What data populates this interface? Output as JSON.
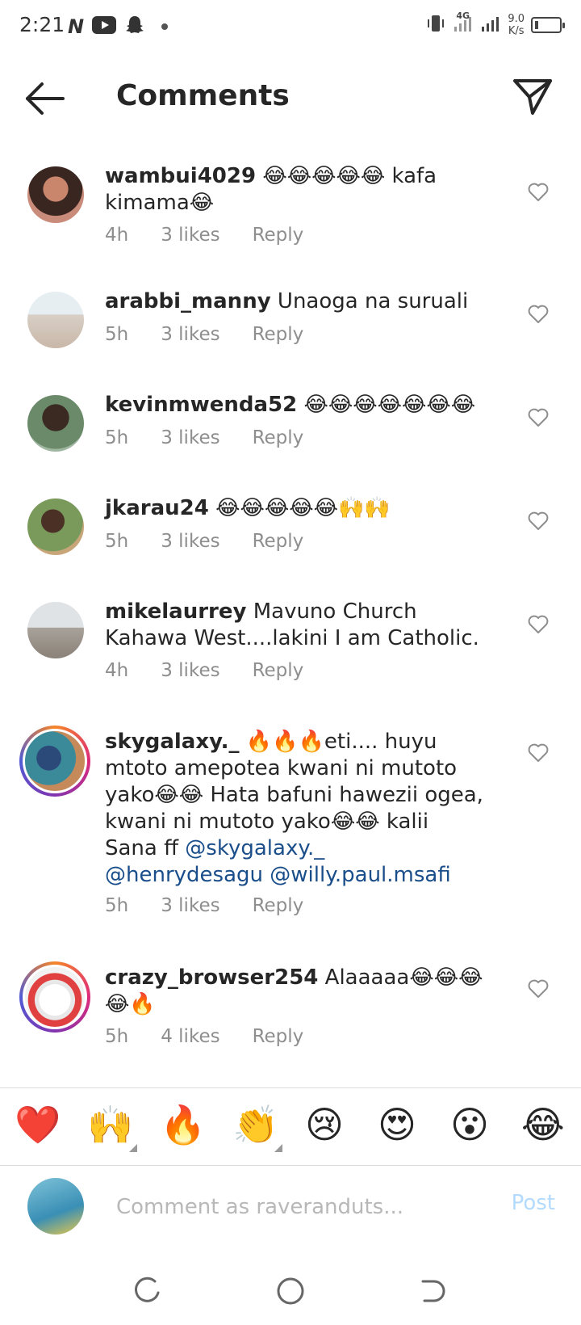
{
  "status_bar": {
    "time": "2:21",
    "network_type": "4G",
    "net_speed_value": "9.0",
    "net_speed_unit": "K/s",
    "icons": [
      "netflix-icon",
      "youtube-icon",
      "snapchat-icon",
      "notification-dot",
      "vibrate-icon",
      "signal-4g-icon",
      "signal-icon",
      "battery-icon"
    ]
  },
  "header": {
    "title": "Comments",
    "back_icon": "back-arrow-icon",
    "share_icon": "send-icon"
  },
  "comments": [
    {
      "username": "wambui4029",
      "text": " 😂😂😂😂😂 kafa kimama😂",
      "time": "4h",
      "likes": "3 likes",
      "reply": "Reply"
    },
    {
      "username": "arabbi_manny",
      "text": " Unaoga na suruali",
      "time": "5h",
      "likes": "3 likes",
      "reply": "Reply"
    },
    {
      "username": "kevinmwenda52",
      "text": " 😂😂😂😂😂😂😂",
      "time": "5h",
      "likes": "3 likes",
      "reply": "Reply"
    },
    {
      "username": "jkarau24",
      "text": " 😂😂😂😂😂🙌🙌",
      "time": "5h",
      "likes": "3 likes",
      "reply": "Reply"
    },
    {
      "username": "mikelaurrey",
      "text": " Mavuno Church Kahawa West....lakini I  am Catholic.",
      "time": "4h",
      "likes": "3 likes",
      "reply": "Reply"
    },
    {
      "username": "skygalaxy._",
      "text": " 🔥🔥🔥eti.... huyu mtoto amepotea kwani ni mutoto yako😂😂 Hata bafuni hawezii ogea, kwani ni mutoto yako😂😂 kalii Sana ff ",
      "mentions": [
        "@skygalaxy._",
        "@henrydesagu",
        "@willy.paul.msafi"
      ],
      "time": "5h",
      "likes": "3 likes",
      "reply": "Reply"
    },
    {
      "username": "crazy_browser254",
      "text": " Alaaaaa😂😂😂😂🔥",
      "time": "5h",
      "likes": "4 likes",
      "reply": "Reply"
    }
  ],
  "reactions": [
    "❤️",
    "🙌",
    "🔥",
    "👏",
    "😢",
    "😍",
    "😮",
    "😂"
  ],
  "compose": {
    "placeholder": "Comment as raveranduts...",
    "post_label": "Post"
  },
  "nav_bar": {
    "icons": [
      "recent-apps-icon",
      "home-icon",
      "back-nav-icon"
    ]
  },
  "colors": {
    "text": "#262626",
    "meta": "#8e8e8e",
    "mention": "#1a4e8a",
    "post_disabled": "#b3dbff",
    "heart_red": "#e0245e"
  }
}
